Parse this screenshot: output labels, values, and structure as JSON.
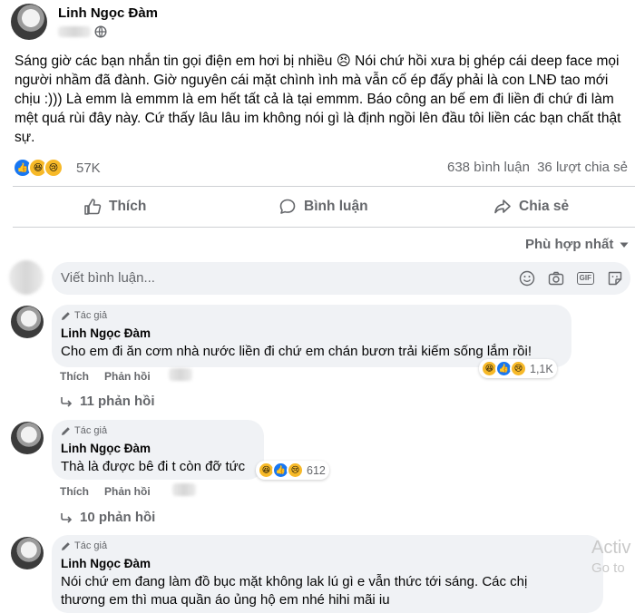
{
  "post": {
    "author": "Linh Ngọc Đàm",
    "text": "Sáng giờ các bạn nhắn tin gọi điện em hơi bị nhiều 😣  Nói chứ hồi xưa bị ghép cái deep face mọi người nhầm đã đành. Giờ nguyên cái mặt chình ình mà vẫn cố ép đấy phải là con LNĐ tao mới chịu :))) Là emm là emmm là em hết tất cả là tại emmm. Báo công an bế em đi liền đi chứ đi làm mệt quá rùi đây này. Cứ thấy lâu lâu im không nói gì là định ngồi lên đầu tôi liền các bạn chất thật sự.",
    "reaction_count": "57K",
    "comments_count": "638 bình luận",
    "shares_count": "36 lượt chia sẻ"
  },
  "actions": {
    "like": "Thích",
    "comment": "Bình luận",
    "share": "Chia sẻ"
  },
  "sort_label": "Phù hợp nhất",
  "comment_box": {
    "placeholder": "Viết bình luận..."
  },
  "comments": [
    {
      "badge": "Tác giả",
      "name": "Linh Ngọc Đàm",
      "text": "Cho em đi ăn cơm nhà nước liền đi chứ em chán bươn trải kiếm sống lắm rồi!",
      "like": "Thích",
      "reply": "Phản hồi",
      "reaction_count": "1,1K",
      "replies": "11 phản hồi"
    },
    {
      "badge": "Tác giả",
      "name": "Linh Ngọc Đàm",
      "text": "Thà là được bê đi t còn đỡ tức",
      "like": "Thích",
      "reply": "Phản hồi",
      "reaction_count": "612",
      "replies": "10 phản hồi"
    },
    {
      "badge": "Tác giả",
      "name": "Linh Ngọc Đàm",
      "text": "Nói chứ em đang làm đồ bục mặt không lak lú gì e vẫn thức tới sáng. Các chị thương em thì mua quần áo ủng hộ em nhé hihi mãi iu"
    }
  ],
  "watermark": {
    "line1": "Activ",
    "line2": "Go to"
  },
  "icons": {
    "gif_label": "GIF"
  }
}
